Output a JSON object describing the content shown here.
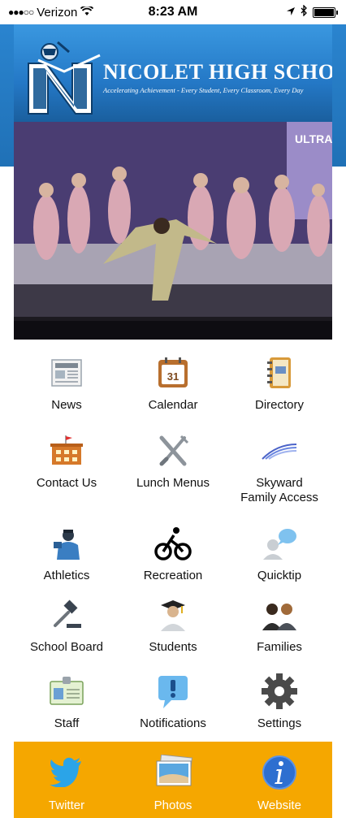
{
  "status_bar": {
    "carrier": "Verizon",
    "time": "8:23 AM"
  },
  "header": {
    "school_name": "NICOLET HIGH SCHOOL",
    "tagline": "Accelerating Achievement - Every Student, Every Classroom, Every Day"
  },
  "photo": {
    "sign_text": "ULTRA CLUTCH"
  },
  "menu": [
    {
      "label": "News",
      "icon": "newspaper-icon"
    },
    {
      "label": "Calendar",
      "icon": "calendar-icon",
      "day": "31"
    },
    {
      "label": "Directory",
      "icon": "address-book-icon"
    },
    {
      "label": "Contact Us",
      "icon": "building-icon"
    },
    {
      "label": "Lunch Menus",
      "icon": "fork-knife-icon"
    },
    {
      "label": "Skyward\nFamily Access",
      "icon": "skyward-logo-icon"
    },
    {
      "label": "Athletics",
      "icon": "coach-icon"
    },
    {
      "label": "Recreation",
      "icon": "bicycle-icon"
    },
    {
      "label": "Quicktip",
      "icon": "chat-person-icon"
    },
    {
      "label": "School Board",
      "icon": "gavel-icon"
    },
    {
      "label": "Students",
      "icon": "graduate-icon"
    },
    {
      "label": "Families",
      "icon": "people-icon"
    },
    {
      "label": "Staff",
      "icon": "id-card-icon"
    },
    {
      "label": "Notifications",
      "icon": "alert-bubble-icon"
    },
    {
      "label": "Settings",
      "icon": "gear-icon"
    }
  ],
  "footer": [
    {
      "label": "Twitter",
      "icon": "twitter-bird-icon"
    },
    {
      "label": "Photos",
      "icon": "photos-icon"
    },
    {
      "label": "Website",
      "icon": "info-icon"
    }
  ],
  "colors": {
    "footer_bg": "#f5a700",
    "header_blue": "#2478c6",
    "outer_blue": "#1f6fb4"
  }
}
